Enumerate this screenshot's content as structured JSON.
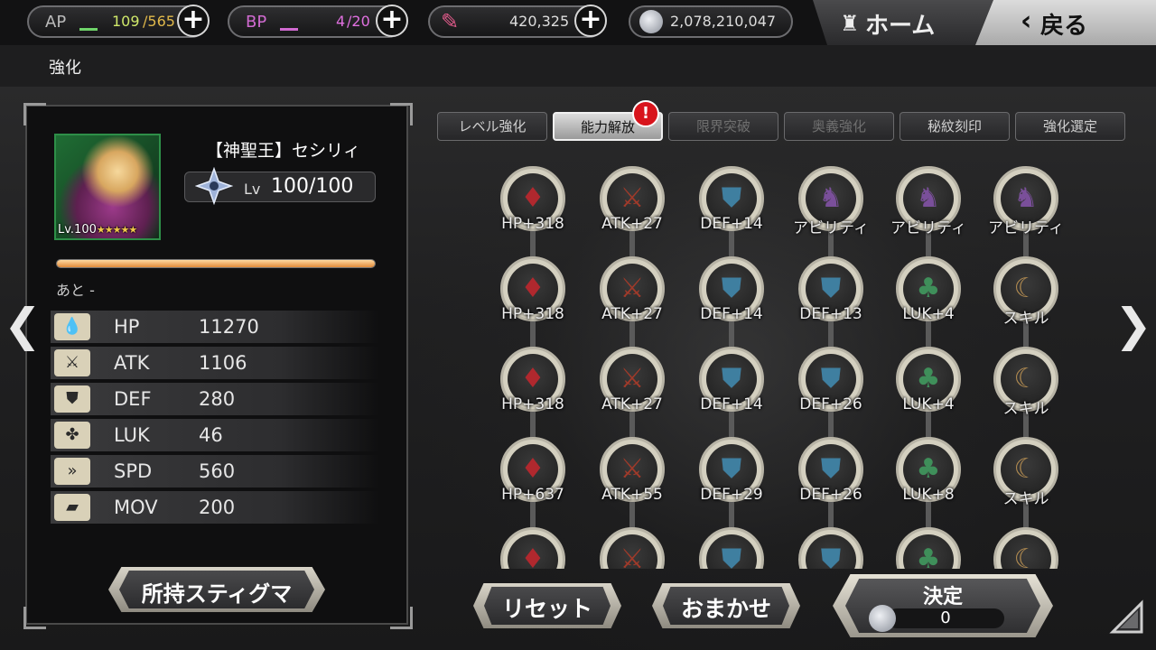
{
  "header": {
    "ap": {
      "label": "AP",
      "value": "109",
      "max": "/565"
    },
    "bp": {
      "label": "BP",
      "value": "4",
      "max": "/20"
    },
    "crystals": "420,325",
    "coins": "2,078,210,047",
    "home_label": "ホーム",
    "back_label": "戻る",
    "page_title": "強化"
  },
  "character": {
    "name": "【神聖王】セシリィ",
    "portrait_level": "Lv.100",
    "stars": "★★★★★",
    "lv_label": "Lv",
    "level": "100/100",
    "remaining": "あと -",
    "exp_fill": 1.0
  },
  "stats": [
    {
      "name": "HP",
      "value": "11270",
      "icon": "hp-drop-icon"
    },
    {
      "name": "ATK",
      "value": "1106",
      "icon": "sword-icon"
    },
    {
      "name": "DEF",
      "value": "280",
      "icon": "shield-icon"
    },
    {
      "name": "LUK",
      "value": "46",
      "icon": "clover-icon"
    },
    {
      "name": "SPD",
      "value": "560",
      "icon": "speed-icon"
    },
    {
      "name": "MOV",
      "value": "200",
      "icon": "boots-icon"
    }
  ],
  "stigma_button": "所持スティグマ",
  "tabs": [
    {
      "label": "レベル強化",
      "state": "normal"
    },
    {
      "label": "能力解放",
      "state": "active"
    },
    {
      "label": "限界突破",
      "state": "disabled"
    },
    {
      "label": "奥義強化",
      "state": "disabled"
    },
    {
      "label": "秘紋刻印",
      "state": "normal"
    },
    {
      "label": "強化選定",
      "state": "normal"
    }
  ],
  "alert_glyph": "!",
  "grid": {
    "columns": [
      {
        "type": "hp",
        "glyph": "♦",
        "color": "#b0282e"
      },
      {
        "type": "atk",
        "glyph": "⚔",
        "color": "#a03a2a"
      },
      {
        "type": "def",
        "glyph": "⛊",
        "color": "#3f7fa0"
      },
      {
        "type": "def",
        "glyph": "⛊",
        "color": "#3f7fa0"
      },
      {
        "type": "luk",
        "glyph": "♣",
        "color": "#3f8f5a"
      },
      {
        "type": "skill",
        "glyph": "☾",
        "color": "#b08a50"
      }
    ],
    "rows": [
      [
        "HP+318",
        "ATK+27",
        "DEF+14",
        "アビリティ",
        "アビリティ",
        "アビリティ"
      ],
      [
        "HP+318",
        "ATK+27",
        "DEF+14",
        "DEF+13",
        "LUK+4",
        "スキル"
      ],
      [
        "HP+318",
        "ATK+27",
        "DEF+14",
        "DEF+26",
        "LUK+4",
        "スキル"
      ],
      [
        "HP+637",
        "ATK+55",
        "DEF+29",
        "DEF+26",
        "LUK+8",
        "スキル"
      ],
      [
        "",
        "",
        "",
        "",
        "",
        ""
      ]
    ],
    "ability_glyph": "♞",
    "ability_color": "#7a4f9a"
  },
  "buttons": {
    "reset": "リセット",
    "auto": "おまかせ",
    "decide": "決定",
    "decide_cost": "0"
  }
}
